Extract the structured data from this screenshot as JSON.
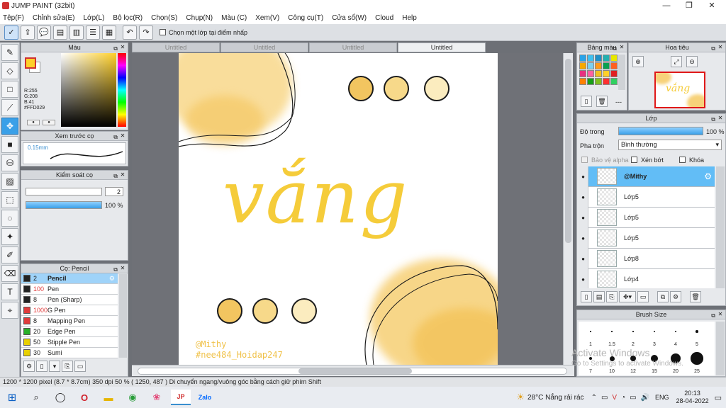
{
  "app": {
    "title": "JUMP PAINT (32bit)"
  },
  "menu": [
    "Tệp(F)",
    "Chỉnh sửa(E)",
    "Lớp(L)",
    "Bộ lọc(R)",
    "Chọn(S)",
    "Chụp(N)",
    "Màu (C)",
    "Xem(V)",
    "Công cụ(T)",
    "Cửa sổ(W)",
    "Cloud",
    "Help"
  ],
  "toolbar": {
    "checkbox_label": "Chọn một lớp tại điểm nhấp"
  },
  "color_panel": {
    "title": "Màu",
    "r": "R:255",
    "g": "G:208",
    "b": "B:41",
    "hex": "#FFD029",
    "primary": "#ffd029"
  },
  "brush_preview": {
    "title": "Xem trước cọ",
    "size": "0.15mm"
  },
  "brush_control": {
    "title": "Kiểm soát cọ",
    "size_value": "2",
    "opacity_value": "100 %",
    "opacity_fraction": 1.0
  },
  "brush_list": {
    "title": "Cọ: Pencil",
    "items": [
      {
        "size": "2",
        "name": "Pencil",
        "color": "#222222",
        "selected": true
      },
      {
        "size": "100",
        "name": "Pen",
        "color": "#222222",
        "selected": false
      },
      {
        "size": "8",
        "name": "Pen (Sharp)",
        "color": "#222222",
        "selected": false
      },
      {
        "size": "1000",
        "name": "G Pen",
        "color": "#e03c3c",
        "selected": false
      },
      {
        "size": "8",
        "name": "Mapping Pen",
        "color": "#e03c3c",
        "selected": false
      },
      {
        "size": "20",
        "name": "Edge Pen",
        "color": "#2ab02a",
        "selected": false
      },
      {
        "size": "50",
        "name": "Stipple Pen",
        "color": "#e8d000",
        "selected": false
      },
      {
        "size": "30",
        "name": "Sumi",
        "color": "#e8d000",
        "selected": false
      }
    ]
  },
  "tabs": [
    "Untitled",
    "Untitled",
    "Untitled",
    "Untitled"
  ],
  "canvas": {
    "main_text": "vắng",
    "signature": "@Mithy",
    "hashtag": "#nee484_Hoidap247"
  },
  "swatch_panel": {
    "title": "Bảng màu",
    "add_label": "---"
  },
  "navigator": {
    "title": "Hoa tiêu"
  },
  "layers_panel": {
    "title": "Lớp",
    "opacity_label": "Độ trong",
    "opacity_value": "100 %",
    "blend_label": "Pha trộn",
    "blend_value": "Bình thường",
    "protect_alpha": "Bảo vệ alpha",
    "clip": "Xén bớt",
    "lock": "Khóa",
    "layers": [
      {
        "name": "@Mithy",
        "selected": true
      },
      {
        "name": "Lớp5",
        "selected": false
      },
      {
        "name": "Lớp5",
        "selected": false
      },
      {
        "name": "Lớp5",
        "selected": false
      },
      {
        "name": "Lớp8",
        "selected": false
      },
      {
        "name": "Lớp4",
        "selected": false
      }
    ]
  },
  "brush_size": {
    "title": "Brush Size",
    "row1": [
      "1",
      "1.5",
      "2",
      "3",
      "4",
      "5"
    ],
    "row2": [
      "7",
      "10",
      "12",
      "15",
      "20",
      "25"
    ]
  },
  "watermark": {
    "line1": "Activate Windows",
    "line2": "Go to Settings to activate Windows."
  },
  "status": {
    "text": "1200 * 1200 pixel  (8.7 * 8.7cm)  350 dpi  50 %  ( 1250, 487 )  Di chuyển ngang/vuông góc bằng cách giữ phím Shift"
  },
  "taskbar": {
    "weather": "28°C  Nắng rải rác",
    "lang": "ENG",
    "time": "20:13",
    "date": "28-04-2022"
  }
}
